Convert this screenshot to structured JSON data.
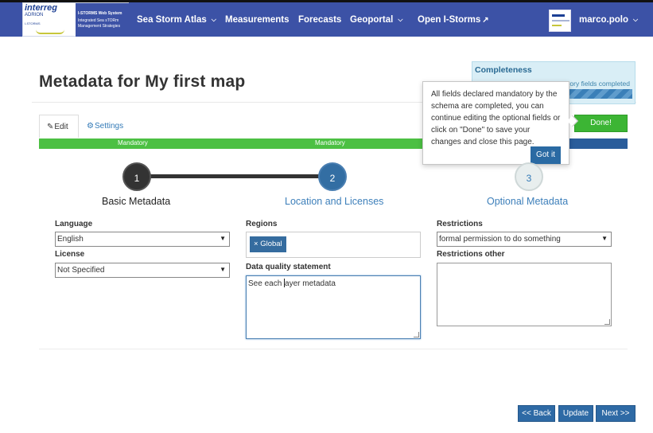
{
  "navbar": {
    "logo": {
      "brand": "interreg",
      "program": "ADRION",
      "project": "I-STORMS",
      "title_line1": "I-STORMS Web System",
      "title_line2": "Integrated Sea sTORm Management Strategies"
    },
    "items": [
      {
        "label": "Sea Storm Atlas",
        "has_caret": true
      },
      {
        "label": "Measurements",
        "has_caret": false
      },
      {
        "label": "Forecasts",
        "has_caret": false
      },
      {
        "label": "Geoportal",
        "has_caret": true
      },
      {
        "label": "Open I-Storms",
        "external_icon": "external-link-icon"
      }
    ],
    "user": {
      "name": "marco.polo"
    },
    "colors": {
      "background": "#3c52a6"
    }
  },
  "page": {
    "title": "Metadata for My first map"
  },
  "completeness": {
    "title": "Completeness",
    "text": "ory fields completed"
  },
  "tabs": {
    "edit": "Edit",
    "settings": "Settings"
  },
  "done_button": "Done!",
  "mandatory_bar": {
    "labels": [
      "Mandatory",
      "Mandatory"
    ]
  },
  "popover": {
    "text": "All fields declared mandatory by the schema are completed, you can continue editing the optional fields or click on \"Done\" to save your changes and close this page.",
    "button": "Got it"
  },
  "stepper": {
    "steps": [
      {
        "number": "1",
        "label": "Basic Metadata"
      },
      {
        "number": "2",
        "label": "Location and Licenses"
      },
      {
        "number": "3",
        "label": "Optional Metadata"
      }
    ]
  },
  "form": {
    "language": {
      "label": "Language",
      "value": "English"
    },
    "license": {
      "label": "License",
      "value": "Not Specified"
    },
    "regions": {
      "label": "Regions",
      "tags": [
        "Global"
      ]
    },
    "data_quality": {
      "label": "Data quality statement",
      "value_before_cursor": "See each ",
      "value_after_cursor": "ayer metadata"
    },
    "restrictions": {
      "label": "Restrictions",
      "value": "formal permission to do something"
    },
    "restrictions_other": {
      "label": "Restrictions other",
      "value": ""
    }
  },
  "footer": {
    "back": "<< Back",
    "update": "Update",
    "next": "Next >>"
  }
}
